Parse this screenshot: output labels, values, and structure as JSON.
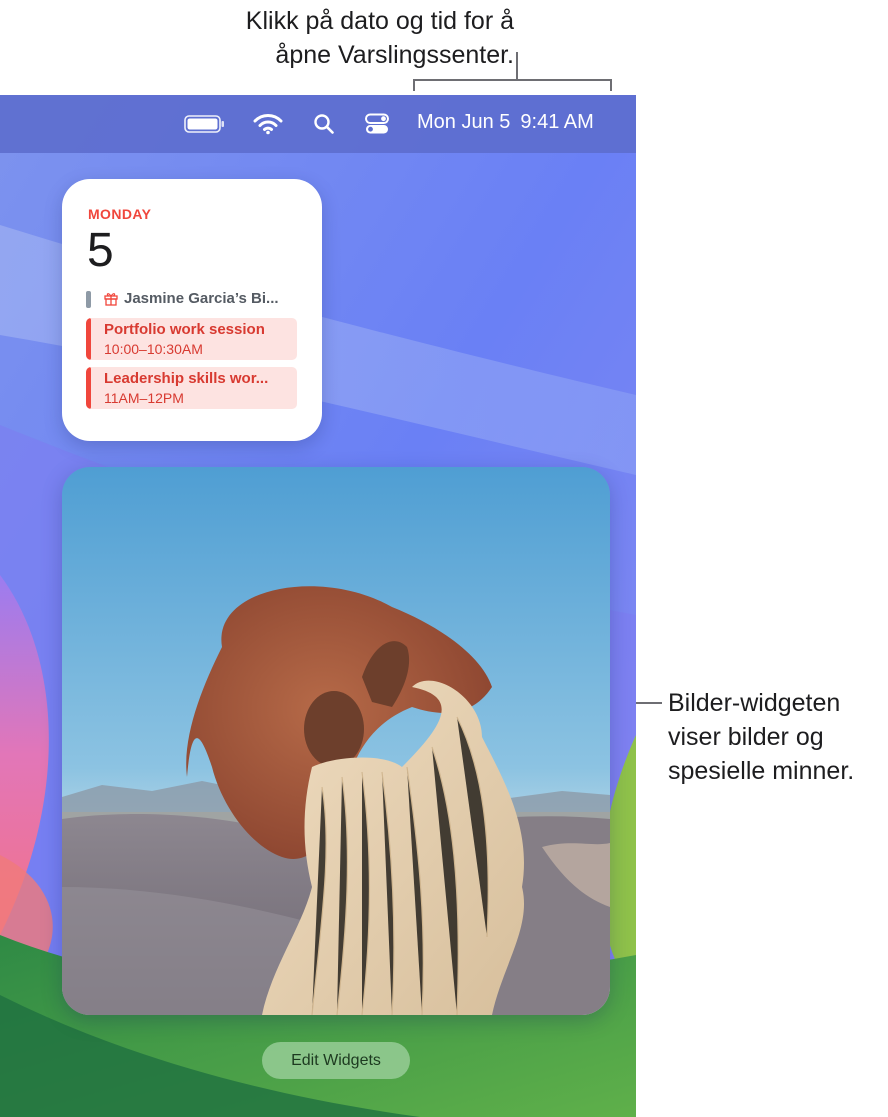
{
  "callouts": {
    "top_line1": "Klikk på dato og tid for å",
    "top_line2": "åpne Varslingssenter.",
    "right_line1": "Bilder-widgeten",
    "right_line2": "viser bilder og",
    "right_line3": "spesielle minner."
  },
  "menubar": {
    "icons": [
      "battery-icon",
      "wifi-icon",
      "search-icon",
      "control-center-icon"
    ],
    "date": "Mon Jun 5",
    "time": "9:41 AM"
  },
  "calendar_widget": {
    "weekday": "MONDAY",
    "day_number": "5",
    "all_day_event": "Jasmine Garcia’s Bi...",
    "events": [
      {
        "title": "Portfolio work session",
        "time": "10:00–10:30AM"
      },
      {
        "title": "Leadership skills wor...",
        "time": "11AM–12PM"
      }
    ],
    "accent_color": "#f0463c"
  },
  "photos_widget": {
    "description_icon": "photo-icon"
  },
  "edit_widgets_label": "Edit Widgets"
}
